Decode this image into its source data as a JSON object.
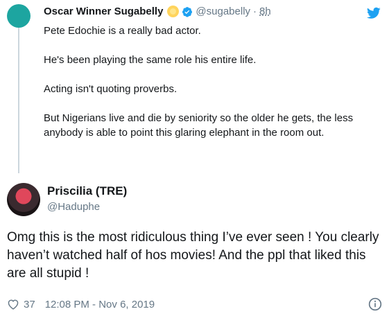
{
  "parent": {
    "display_name": "Oscar Winner Sugabelly",
    "emoji_icon": "sun-face-emoji",
    "verified_icon": "verified-badge-icon",
    "handle": "@sugabelly",
    "separator": "·",
    "time_ago": "8h",
    "paragraphs": [
      "Pete Edochie is a really bad actor.",
      "He's been playing the same role his entire life.",
      "Acting isn't quoting proverbs.",
      "But Nigerians live and die by seniority so the older he gets, the less anybody is able to point this glaring elephant in the room out."
    ]
  },
  "reply": {
    "display_name": "Priscilia (TRE)",
    "handle": "@Haduphe",
    "text": "Omg this is the most ridiculous thing I’ve ever  seen ! You clearly haven’t watched half of hos movies! And the ppl that liked this are all stupid !",
    "like_count": "37",
    "timestamp": "12:08 PM - Nov 6, 2019"
  },
  "colors": {
    "brand": "#1da1f2",
    "text": "#14171a",
    "muted": "#657786",
    "thread_line": "#ccd6dd"
  }
}
